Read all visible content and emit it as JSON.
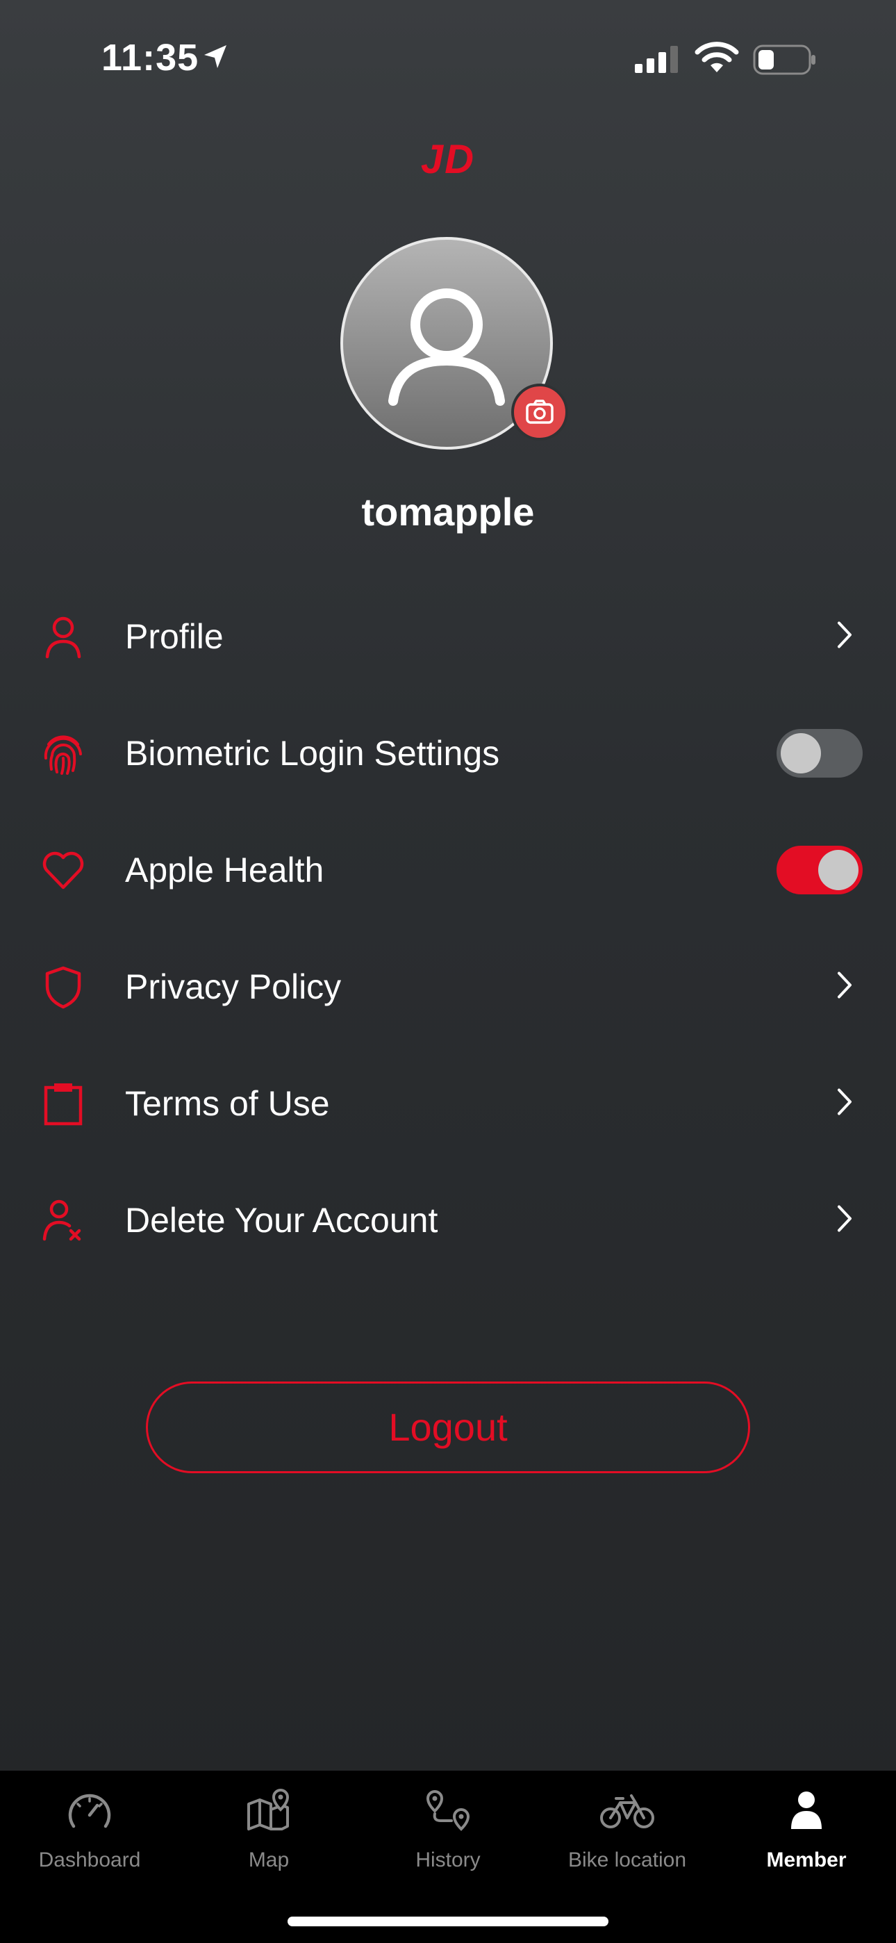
{
  "status_bar": {
    "time": "11:35"
  },
  "header": {
    "brand": "JD"
  },
  "profile": {
    "username": "tomapple"
  },
  "menu": {
    "items": [
      {
        "label": "Profile",
        "icon": "person-icon",
        "type": "link"
      },
      {
        "label": "Biometric Login Settings",
        "icon": "fingerprint-icon",
        "type": "toggle",
        "on": false
      },
      {
        "label": "Apple Health",
        "icon": "heart-icon",
        "type": "toggle",
        "on": true
      },
      {
        "label": "Privacy Policy",
        "icon": "shield-icon",
        "type": "link"
      },
      {
        "label": "Terms of Use",
        "icon": "clipboard-icon",
        "type": "link"
      },
      {
        "label": "Delete Your Account",
        "icon": "person-remove-icon",
        "type": "link"
      }
    ]
  },
  "logout": {
    "label": "Logout"
  },
  "tabbar": {
    "tabs": [
      {
        "label": "Dashboard",
        "icon": "speedometer-icon",
        "active": false
      },
      {
        "label": "Map",
        "icon": "map-pin-icon",
        "active": false
      },
      {
        "label": "History",
        "icon": "route-icon",
        "active": false
      },
      {
        "label": "Bike location",
        "icon": "bicycle-icon",
        "active": false
      },
      {
        "label": "Member",
        "icon": "member-icon",
        "active": true
      }
    ]
  },
  "colors": {
    "accent": "#e30d24",
    "background_top": "#3a3d40",
    "background_bottom": "#232527",
    "tabbar": "#000000",
    "toggle_off": "#5a5d60",
    "toggle_on": "#e30d24"
  }
}
